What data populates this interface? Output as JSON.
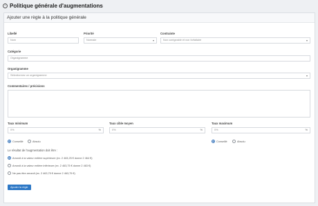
{
  "header": {
    "title": "Politique générale d'augmentations"
  },
  "panel": {
    "title": "Ajouter une règle à la politique générale"
  },
  "form": {
    "libelle": {
      "label": "Libellé",
      "placeholder": "Nom"
    },
    "priorite": {
      "label": "Priorité",
      "value": "Normale"
    },
    "contrainte": {
      "label": "Contrainte",
      "value": "Non corrigeable et non forfaitaire"
    },
    "categorie": {
      "label": "Catégorie",
      "value": "Organigramme"
    },
    "organigramme": {
      "label": "Organigramme",
      "value": "Sélectionnez un organigramme"
    },
    "commentaires": {
      "label": "Commentaires / précisions"
    },
    "taux_minimum": {
      "label": "Taux minimum",
      "value": "0%",
      "unit": "%"
    },
    "taux_moyen": {
      "label": "Taux cible moyen",
      "value": "0%",
      "unit": "%"
    },
    "taux_maximum": {
      "label": "Taux maximum",
      "value": "0%",
      "unit": "%"
    },
    "radio_group_1": {
      "opt_a": "Conseillé",
      "opt_b": "Absolu"
    },
    "radio_group_2": {
      "opt_a": "Conseillé",
      "opt_b": "Absolu"
    },
    "rounding": {
      "question": "Le résultat de l'augmentation doit être :",
      "options": [
        "Arrondi à la valeur entière supérieure (ex. 2 463,25 € donne 2 464 €)",
        "Arrondi à la valeur entière inférieure (ex. 2 463,75 € donne 2 463 €)",
        "Ne pas être arrondi (ex. 2 463,75 € donne 2 463,75 €)"
      ]
    },
    "submit_label": "Ajouter la règle"
  }
}
